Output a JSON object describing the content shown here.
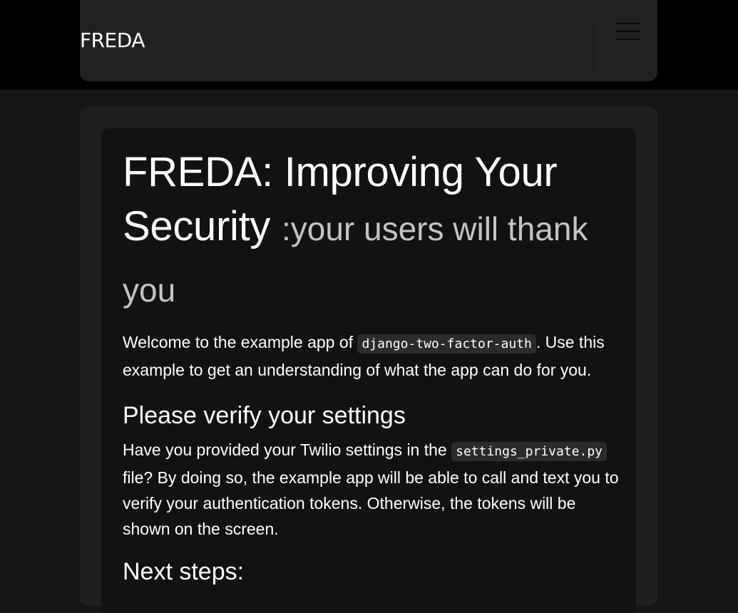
{
  "navbar": {
    "brand": "FREDA",
    "toggler_icon": "hamburger-menu-icon"
  },
  "main": {
    "title": "FREDA: Improving Your Security",
    "subtitle": ":your users will thank you",
    "intro": {
      "before": "Welcome to the example app of ",
      "code": "django-two-factor-auth",
      "after": ". Use this example to get an understanding of what the app can do for you."
    },
    "verify": {
      "heading": "Please verify your settings",
      "before": "Have you provided your Twilio settings in the ",
      "code": "settings_private.py",
      "after": " file? By doing so, the example app will be able to call and text you to verify your authentication tokens. Otherwise, the tokens will be shown on the screen."
    },
    "next_heading": "Next steps:"
  }
}
